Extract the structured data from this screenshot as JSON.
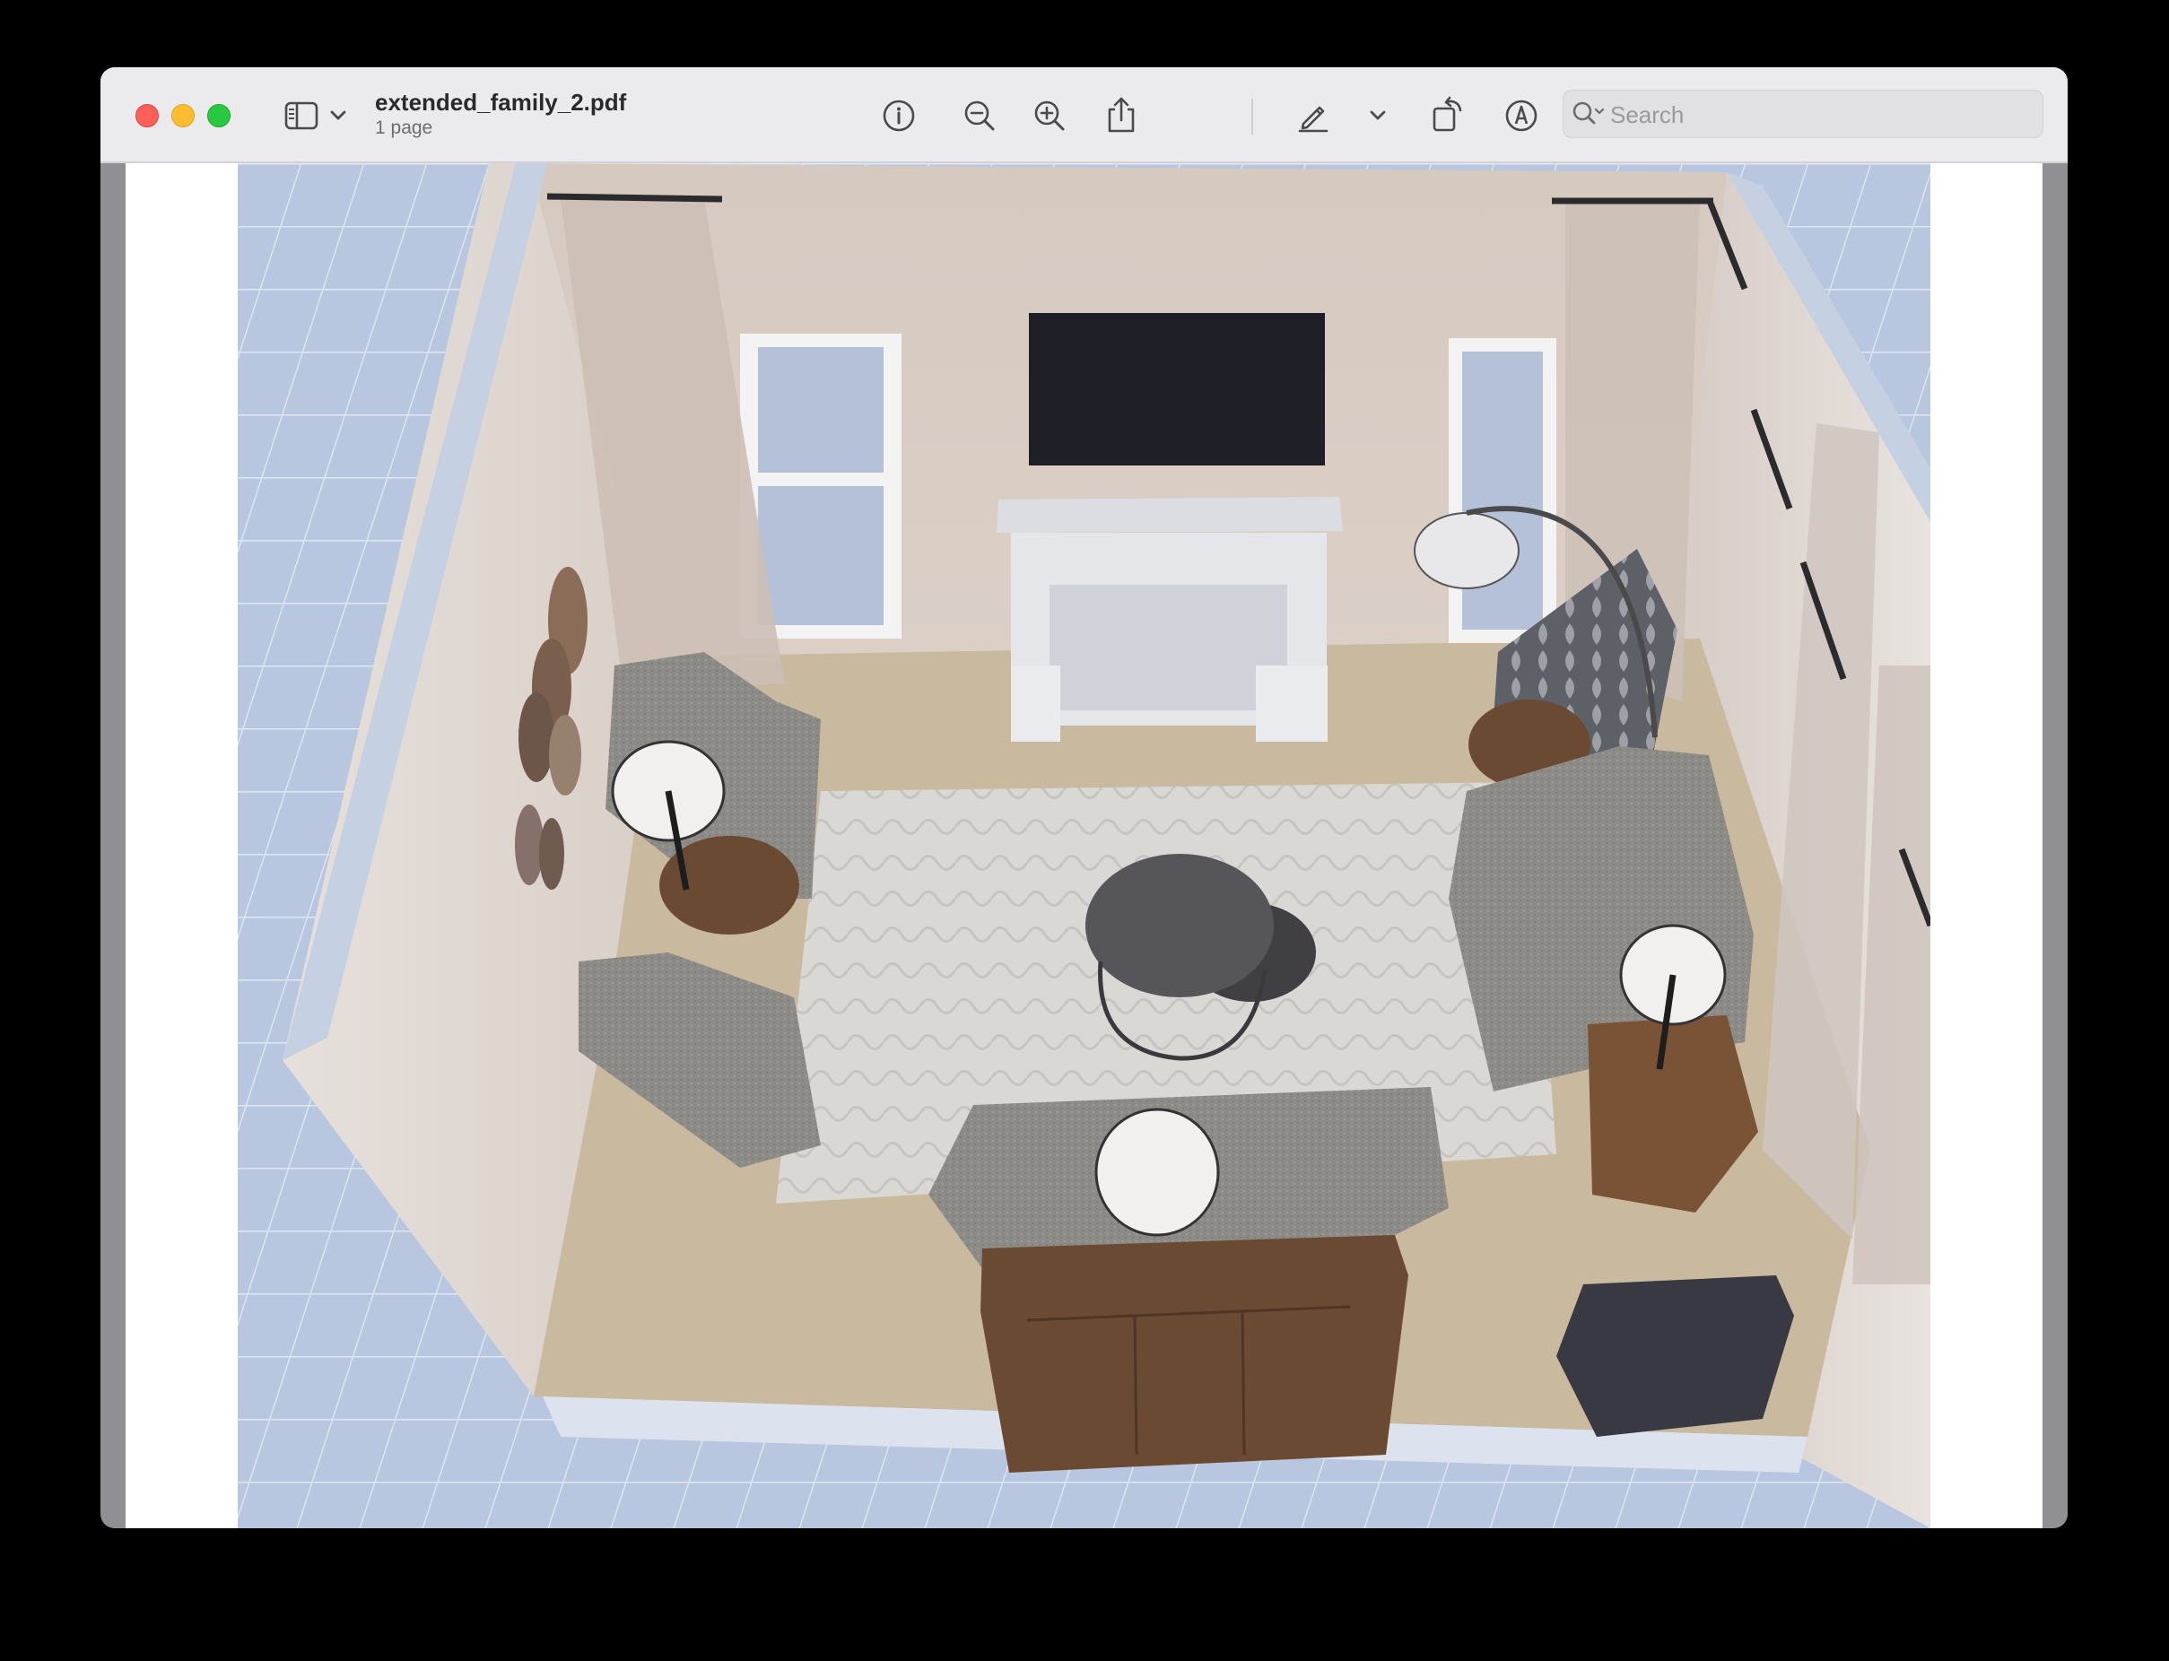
{
  "window": {
    "title": "extended_family_2.pdf",
    "subtitle": "1 page"
  },
  "toolbar": {
    "sidebar_toggle": "sidebar-icon",
    "info": "info-icon",
    "zoom_out": "zoom-out-icon",
    "zoom_in": "zoom-in-icon",
    "share": "share-icon",
    "markup": "pencil-icon",
    "rotate": "rotate-icon",
    "annotate": "markup-pen-icon",
    "form_fill": "signature-icon"
  },
  "search": {
    "placeholder": "Search",
    "value": ""
  },
  "colors": {
    "titlebar": "#ebebed",
    "close": "#fe5f57",
    "minimize": "#febc2e",
    "maximize": "#28c840",
    "wall": "#d9cfc6",
    "floor": "#c8b89e",
    "rug": "#d8d8d6",
    "fabric": "#8a8987",
    "wood": "#6b4a33",
    "tv": "#1f1f28"
  }
}
